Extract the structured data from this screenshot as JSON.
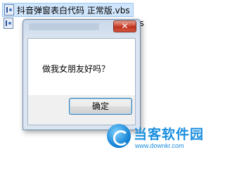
{
  "explorer": {
    "files": [
      {
        "name": "抖音弹窗表白代码 正常版.vbs",
        "selected": true
      },
      {
        "name": ".vbs",
        "selected": false
      }
    ]
  },
  "dialog": {
    "close_label": "✕",
    "message": "做我女朋友好吗？",
    "ok_label": "确定"
  },
  "watermark": {
    "title": "当客软件园",
    "url": "www.downkr.com"
  },
  "colors": {
    "selection": "#cfe5fb",
    "close_button": "#c9432f",
    "watermark": "#1a8fe0"
  }
}
